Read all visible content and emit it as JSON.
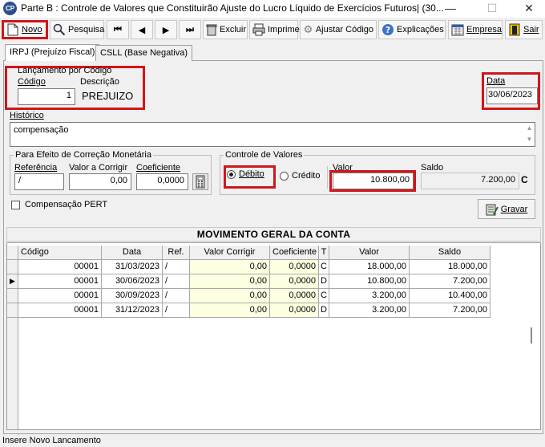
{
  "window": {
    "app_icon_text": "CP",
    "title": "Parte B : Controle de Valores que Constituirão Ajuste do Lucro Líquido de Exercícios Futuros| (30...",
    "minimize": "—",
    "maximize": "☐",
    "close": "✕"
  },
  "toolbar": {
    "novo": "Novo",
    "pesquisa": "Pesquisa",
    "first": "⏮",
    "prev": "◀",
    "next": "▶",
    "last": "⏭",
    "excluir": "Excluir",
    "imprime": "Imprime",
    "ajustar": "Ajustar Código",
    "explicacoes": "Explicações",
    "empresa": "Empresa",
    "sair": "Sair"
  },
  "tabs": [
    {
      "label": "IRPJ (Prejuízo Fiscal)"
    },
    {
      "label": "CSLL (Base Negativa)"
    }
  ],
  "lancamento": {
    "legend": "Lançamento por Código",
    "codigo_label": "Código",
    "codigo_value": "1",
    "descricao_label": "Descrição",
    "descricao_value": "PREJUIZO"
  },
  "data": {
    "label": "Data",
    "value": "30/06/2023"
  },
  "historico": {
    "label": "Histórico",
    "value": "compensação"
  },
  "correcao": {
    "legend": "Para Efeito de Correção Monetária",
    "referencia_label": "Referência",
    "referencia_value": "/",
    "valor_corrigir_label": "Valor a Corrigir",
    "valor_corrigir_value": "0,00",
    "coeficiente_label": "Coeficiente",
    "coeficiente_value": "0,0000"
  },
  "controle": {
    "legend": "Controle de Valores",
    "debito": "Débito",
    "credito": "Crédito",
    "selected": "Débito",
    "valor_label": "Valor",
    "valor_value": "10.800,00",
    "saldo_label": "Saldo",
    "saldo_value": "7.200,00",
    "saldo_tipo": "C"
  },
  "pert": {
    "label": "Compensação PERT",
    "checked": false
  },
  "gravar_label": "Gravar",
  "grid": {
    "title": "MOVIMENTO GERAL DA CONTA",
    "columns": [
      "Código",
      "Data",
      "Ref.",
      "Valor Corrigir",
      "Coeficiente",
      "T",
      "Valor",
      "Saldo"
    ],
    "rows": [
      {
        "codigo": "00001",
        "data": "31/03/2023",
        "ref": "/",
        "valor_corrigir": "0,00",
        "coeficiente": "0,0000",
        "t": "C",
        "valor": "18.000,00",
        "saldo": "18.000,00"
      },
      {
        "codigo": "00001",
        "data": "30/06/2023",
        "ref": "/",
        "valor_corrigir": "0,00",
        "coeficiente": "0,0000",
        "t": "D",
        "valor": "10.800,00",
        "saldo": "7.200,00"
      },
      {
        "codigo": "00001",
        "data": "30/09/2023",
        "ref": "/",
        "valor_corrigir": "0,00",
        "coeficiente": "0,0000",
        "t": "C",
        "valor": "3.200,00",
        "saldo": "10.400,00"
      },
      {
        "codigo": "00001",
        "data": "31/12/2023",
        "ref": "/",
        "valor_corrigir": "0,00",
        "coeficiente": "0,0000",
        "t": "D",
        "valor": "3.200,00",
        "saldo": "7.200,00"
      }
    ],
    "current_row_marker": "▶"
  },
  "status": {
    "text": "Insere Novo Lancamento"
  },
  "colors": {
    "highlight": "#d0161b",
    "grid_yellow": "#ffffe1"
  }
}
